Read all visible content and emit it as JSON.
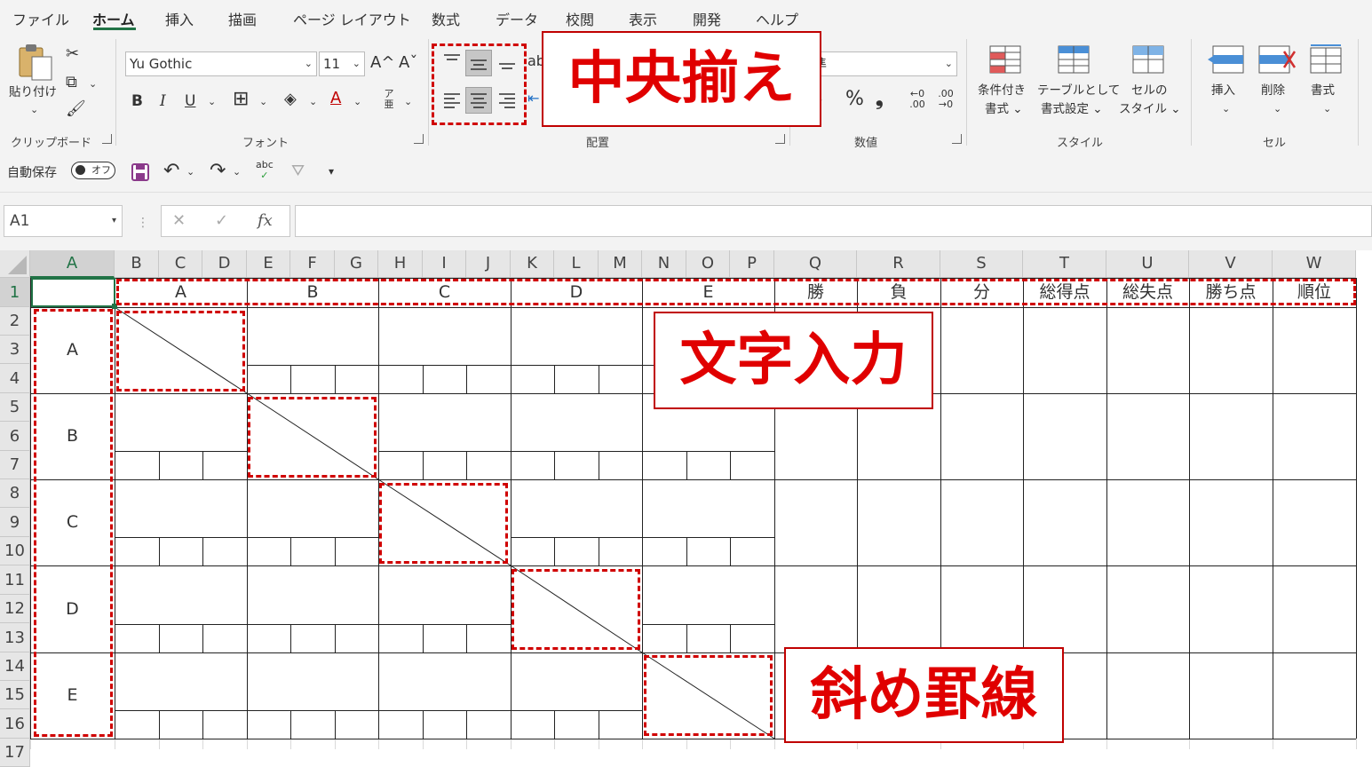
{
  "ribbon": {
    "tabs": [
      "ファイル",
      "ホーム",
      "挿入",
      "描画",
      "ページ レイアウト",
      "数式",
      "データ",
      "校閲",
      "表示",
      "開発",
      "ヘルプ"
    ],
    "active_tab": "ホーム",
    "clipboard": {
      "paste_label": "貼り付け",
      "group": "クリップボード"
    },
    "font": {
      "name": "Yu Gothic",
      "size": "11",
      "group": "フォント",
      "bold": "B",
      "italic": "I",
      "underline": "U",
      "phonetic": "ア亜"
    },
    "alignment": {
      "group": "配置"
    },
    "number": {
      "format": "標準",
      "group": "数値",
      "percent": "%",
      "comma": "❟"
    },
    "styles": {
      "group": "スタイル",
      "conditional": [
        "条件付き",
        "書式 ⌄"
      ],
      "table": [
        "テーブルとして",
        "書式設定 ⌄"
      ],
      "cell": [
        "セルの",
        "スタイル ⌄"
      ]
    },
    "cells": {
      "group": "セル",
      "insert": "挿入",
      "delete": "削除",
      "format": "書式"
    }
  },
  "qat": {
    "autosave_label": "自動保存",
    "toggle_state": "オフ"
  },
  "formula_bar": {
    "name_box": "A1",
    "fx": "fx"
  },
  "sheet": {
    "columns": [
      "A",
      "B",
      "C",
      "D",
      "E",
      "F",
      "G",
      "H",
      "I",
      "J",
      "K",
      "L",
      "M",
      "N",
      "O",
      "P",
      "Q",
      "R",
      "S",
      "T",
      "U",
      "V",
      "W"
    ],
    "rows": [
      "1",
      "2",
      "3",
      "4",
      "5",
      "6",
      "7",
      "8",
      "9",
      "10",
      "11",
      "12",
      "13",
      "14",
      "15",
      "16",
      "17"
    ],
    "header_teams": [
      "A",
      "B",
      "C",
      "D",
      "E"
    ],
    "header_stats": [
      "勝",
      "負",
      "分",
      "総得点",
      "総失点",
      "勝ち点",
      "順位"
    ],
    "row_teams": [
      "A",
      "B",
      "C",
      "D",
      "E"
    ]
  },
  "callouts": {
    "center": "中央揃え",
    "text": "文字入力",
    "diagonal": "斜め罫線"
  },
  "colors": {
    "accent": "#217346",
    "annotation_red": "#e00000"
  }
}
